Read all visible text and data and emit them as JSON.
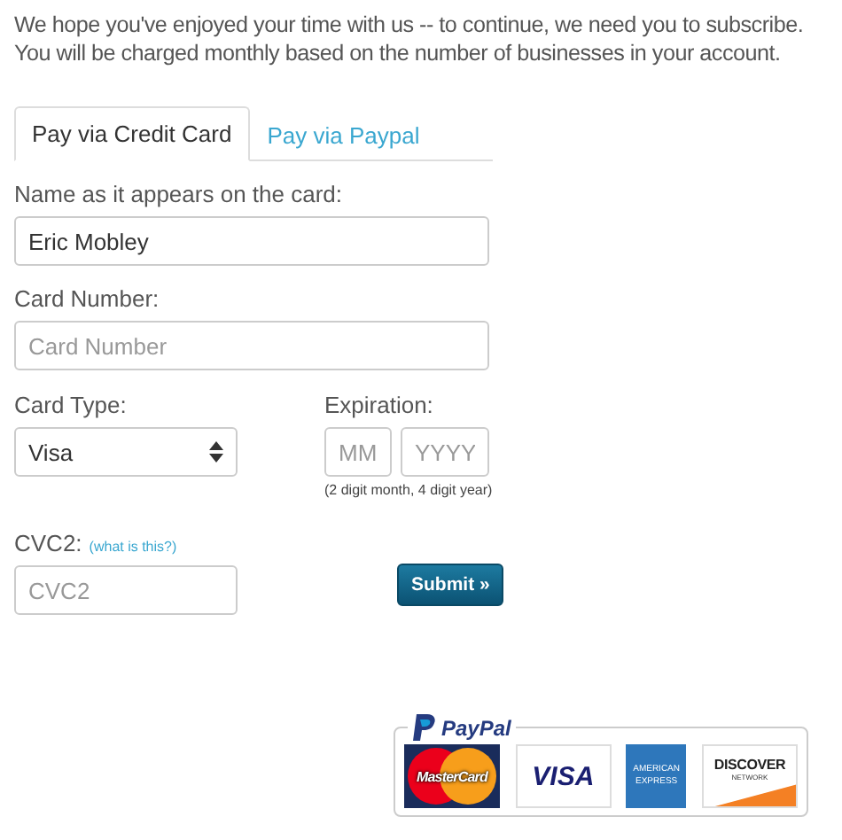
{
  "intro": "We hope you've enjoyed your time with us -- to continue, we need you to subscribe. You will be charged monthly based on the number of businesses in your account.",
  "tabs": [
    {
      "label": "Pay via Credit Card",
      "selected": true
    },
    {
      "label": "Pay via Paypal",
      "selected": false
    }
  ],
  "name_field": {
    "label": "Name as it appears on the card:",
    "value": "Eric Mobley"
  },
  "card_number_field": {
    "label": "Card Number:",
    "placeholder": "Card Number"
  },
  "card_type": {
    "label": "Card Type:",
    "value": "Visa"
  },
  "expiration": {
    "label": "Expiration:",
    "month_placeholder": "MM",
    "year_placeholder": "YYYY",
    "hint": "(2 digit month, 4 digit year)"
  },
  "cvc": {
    "label": "CVC2:",
    "help_link": "(what is this?)",
    "placeholder": "CVC2"
  },
  "submit": {
    "label": "Submit",
    "arrow": "»"
  },
  "payment_badge": {
    "title": "PayPal",
    "cards": [
      {
        "kind": "mastercard",
        "text": "MasterCard"
      },
      {
        "kind": "visa",
        "text": "VISA"
      },
      {
        "kind": "amex",
        "text": "AMERICAN EXPRESS"
      },
      {
        "kind": "discover",
        "text": "DISCOVER",
        "subtext": "NETWORK"
      }
    ]
  }
}
